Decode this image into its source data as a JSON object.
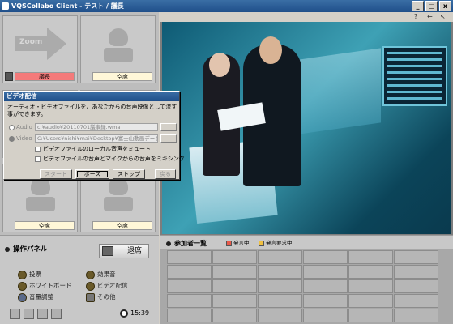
{
  "window": {
    "title": "VQSCollabo Client - テスト / 議長",
    "buttons": [
      "_",
      "□",
      "x"
    ]
  },
  "tiles": [
    {
      "label": "議長",
      "status": "chair",
      "content": "zoom-arrow",
      "zoom_text": "Zoom"
    },
    {
      "label": "空席",
      "status": "empty"
    },
    {
      "label": "",
      "status": "hidden"
    },
    {
      "label": "",
      "status": "hidden"
    },
    {
      "label": "空席",
      "status": "empty"
    },
    {
      "label": "空席",
      "status": "empty"
    }
  ],
  "toolbar_icons": [
    "?",
    "←",
    "↖"
  ],
  "dialog": {
    "title": "ビデオ配信",
    "description": "オーディオ・ビデオファイルを、あなたからの音声映像として流す事ができます。",
    "audio_label": "Audio",
    "audio_path": "c:¥audio¥20110701議事録.wma",
    "video_label": "Video",
    "video_path": "C:¥Users¥nishi¥mai¥Desktop¥富士山動画データ¥",
    "check_local": "ビデオファイルのローカル音声をミュート",
    "check_mix": "ビデオファイルの音声とマイクからの音声をミキシング",
    "buttons": {
      "start": "スタート",
      "pause": "ポーズ",
      "stop": "ストップ",
      "back": "戻る"
    }
  },
  "control_panel": {
    "title": "操作パネル",
    "exit_label": "退席",
    "items": [
      {
        "label": "投票"
      },
      {
        "label": "効果音"
      },
      {
        "label": "ホワイトボード"
      },
      {
        "label": "ビデオ配信"
      },
      {
        "label": "音量調整"
      },
      {
        "label": "その他"
      }
    ],
    "clock": "15:39",
    "colors": {
      "toggle": "#6a5a2a"
    }
  },
  "participants": {
    "title": "参加者一覧",
    "legend": [
      {
        "label": "発言中",
        "color": "#e85a4a"
      },
      {
        "label": "発言要求中",
        "color": "#f0c040"
      }
    ],
    "rows": 5,
    "cols": 6
  },
  "colors": {
    "titlebar": "#1f4f8a",
    "chair_label": "#f47a7a",
    "empty_label": "#fff7d8"
  }
}
